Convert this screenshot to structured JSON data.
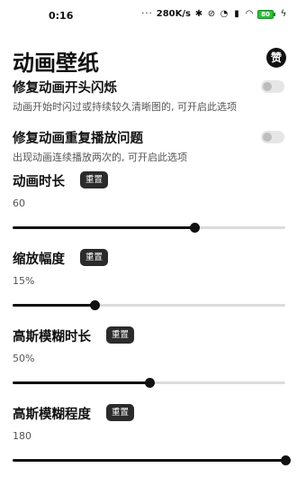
{
  "status_bar": {
    "time": "0:16",
    "dots": "···",
    "speed": "280K/s",
    "icons": [
      "bluetooth-icon",
      "alarm-icon",
      "clock-icon",
      "signal-icon",
      "wifi-icon"
    ],
    "battery": "80"
  },
  "header": {
    "title": "动画壁纸",
    "sponsor_glyph": "赞"
  },
  "toggles": [
    {
      "title": "修复动画开头闪烁",
      "desc": "动画开始时闪过或持续较久清晰图的, 可开启此选项",
      "on": false
    },
    {
      "title": "修复动画重复播放问题",
      "desc": "出现动画连续播放两次的, 可开启此选项",
      "on": false
    }
  ],
  "sliders": [
    {
      "title": "动画时长",
      "reset": "重置",
      "value": "60",
      "fraction": 0.667
    },
    {
      "title": "缩放幅度",
      "reset": "重置",
      "value": "15%",
      "fraction": 0.3
    },
    {
      "title": "高斯模糊时长",
      "reset": "重置",
      "value": "50%",
      "fraction": 0.5
    },
    {
      "title": "高斯模糊程度",
      "reset": "重置",
      "value": "180",
      "fraction": 1.0
    }
  ],
  "colors": {
    "accent": "#111111",
    "track": "#dcdcdc",
    "battery": "#2fbf3b"
  }
}
